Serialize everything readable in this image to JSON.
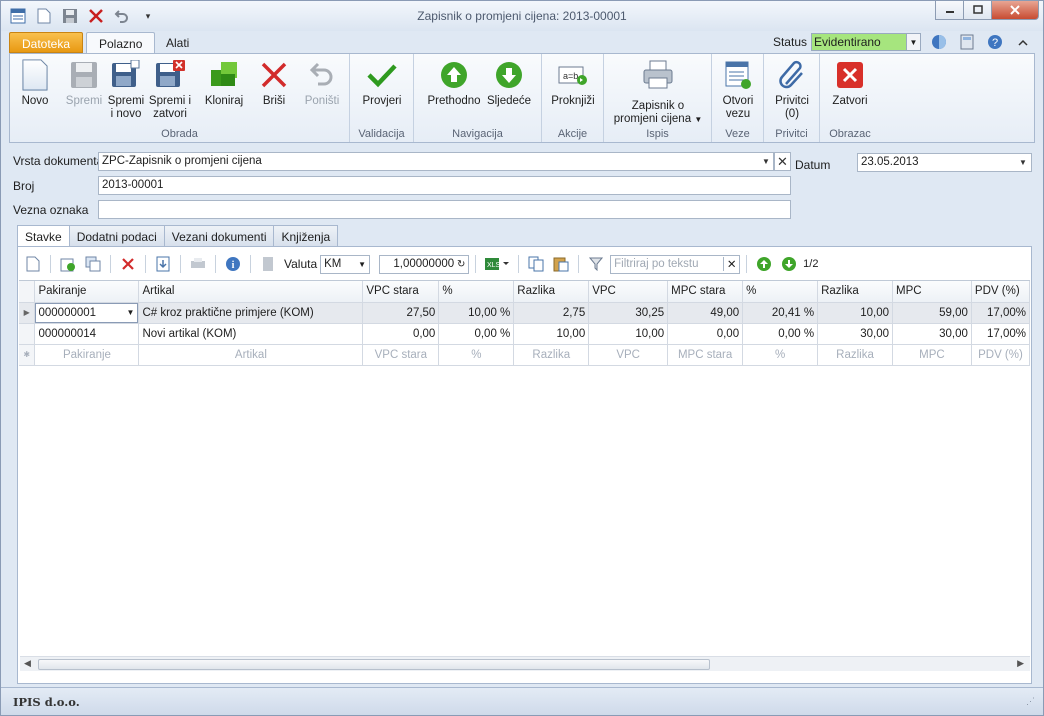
{
  "window": {
    "title": "Zapisnik o promjeni cijena: 2013-00001"
  },
  "ribbon_tabs": [
    "Datoteka",
    "Polazno",
    "Alati"
  ],
  "status": {
    "label": "Status",
    "value": "Evidentirano"
  },
  "ribbon": {
    "groups": [
      "Obrada",
      "Validacija",
      "Navigacija",
      "Akcije",
      "Ispis",
      "Veze",
      "Privitci",
      "Obrazac"
    ],
    "buttons": {
      "novo": "Novo",
      "spremi": "Spremi",
      "spremi_novo_1": "Spremi",
      "spremi_novo_2": "i novo",
      "spremi_zatvori_1": "Spremi i",
      "spremi_zatvori_2": "zatvori",
      "kloniraj": "Kloniraj",
      "brisi": "Briši",
      "ponisti": "Poništi",
      "provjeri": "Provjeri",
      "prethodno": "Prethodno",
      "sljedece": "Sljedeće",
      "proknjizi": "Proknjiži",
      "zapisnik_1": "Zapisnik o",
      "zapisnik_2": "promjeni cijena",
      "otvori_1": "Otvori",
      "otvori_2": "vezu",
      "privitci_1": "Privitci",
      "privitci_2": "(0)",
      "zatvori": "Zatvori"
    }
  },
  "form": {
    "vrsta_label": "Vrsta dokumenta",
    "vrsta_value": "ZPC-Zapisnik o promjeni cijena",
    "broj_label": "Broj",
    "broj_value": "2013-00001",
    "vezna_label": "Vezna oznaka",
    "vezna_value": "",
    "datum_label": "Datum",
    "datum_value": "23.05.2013"
  },
  "page_tabs": [
    "Stavke",
    "Dodatni podaci",
    "Vezani dokumenti",
    "Knjiženja"
  ],
  "toolbar": {
    "valuta_label": "Valuta",
    "valuta_value": "KM",
    "rate": "1,00000000",
    "filter_placeholder": "Filtriraj po tekstu",
    "page": "1/2"
  },
  "grid": {
    "columns": [
      "Pakiranje",
      "Artikal",
      "VPC stara",
      "%",
      "Razlika",
      "VPC",
      "MPC stara",
      "%",
      "Razlika",
      "MPC",
      "PDV (%)"
    ],
    "rows": [
      [
        "000000001",
        "C# kroz praktične primjere (KOM)",
        "27,50",
        "10,00 %",
        "2,75",
        "30,25",
        "49,00",
        "20,41 %",
        "10,00",
        "59,00",
        "17,00%"
      ],
      [
        "000000014",
        "Novi artikal (KOM)",
        "0,00",
        "0,00 %",
        "10,00",
        "10,00",
        "0,00",
        "0,00 %",
        "30,00",
        "30,00",
        "17,00%"
      ]
    ],
    "new_row": [
      "Pakiranje",
      "Artikal",
      "VPC stara",
      "%",
      "Razlika",
      "VPC",
      "MPC stara",
      "%",
      "Razlika",
      "MPC",
      "PDV (%)"
    ]
  },
  "statusbar": {
    "company": "IPIS d.o.o."
  }
}
